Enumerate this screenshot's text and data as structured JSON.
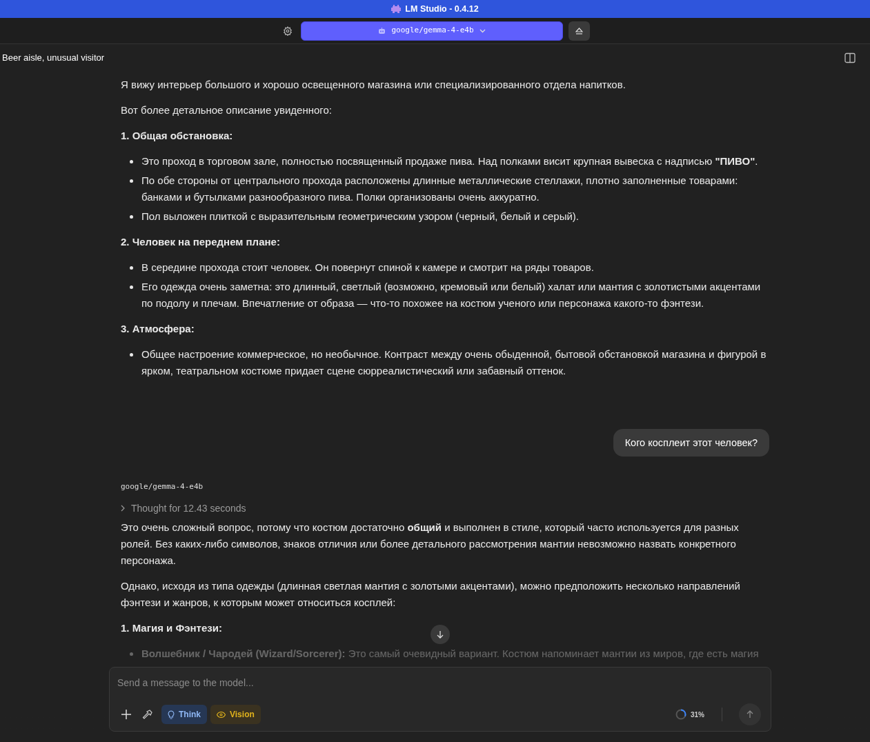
{
  "window": {
    "title": "LM Studio - 0.4.12"
  },
  "toolbar": {
    "model": "google/gemma-4-e4b"
  },
  "chat": {
    "title": "Beer aisle, unusual visitor",
    "messages": [
      {
        "kind": "assistant",
        "blocks": [
          {
            "kind": "paragraph",
            "text": "Я вижу интерьер большого и хорошо освещенного магазина или специализированного отдела напитков."
          },
          {
            "kind": "paragraph",
            "text": "Вот более детальное описание увиденного:"
          },
          {
            "kind": "heading",
            "text": "1. Общая обстановка:"
          },
          {
            "kind": "bullets",
            "items": [
              "Это проход в торговом зале, полностью посвященный продаже пива. Над полками висит крупная вывеска с надписью **\"ПИВО\"**.",
              "По обе стороны от центрального прохода расположены длинные металлические стеллажи, плотно заполненные товарами: банками и бутылками разнообразного пива. Полки организованы очень аккуратно.",
              "Пол выложен плиткой с выразительным геометрическим узором (черный, белый и серый)."
            ]
          },
          {
            "kind": "heading",
            "text": "2. Человек на переднем плане:"
          },
          {
            "kind": "bullets",
            "items": [
              "В середине прохода стоит человек. Он повернут спиной к камере и смотрит на ряды товаров.",
              "Его одежда очень заметна: это длинный, светлый (возможно, кремовый или белый) халат или мантия с золотистыми акцентами по подолу и плечам. Впечатление от образа — что-то похожее на костюм ученого или персонажа какого-то фэнтези."
            ]
          },
          {
            "kind": "heading",
            "text": "3. Атмосфера:"
          },
          {
            "kind": "bullets",
            "items": [
              "Общее настроение коммерческое, но необычное. Контраст между очень обыденной, бытовой обстановкой магазина и фигурой в ярком, театральном костюме придает сцене сюрреалистический или забавный оттенок."
            ]
          }
        ]
      },
      {
        "kind": "user",
        "text": "Кого косплеит этот человек?"
      },
      {
        "kind": "assistant",
        "model": "google/gemma-4-e4b",
        "thought": "Thought for 12.43 seconds",
        "blocks": [
          {
            "kind": "paragraph",
            "text": "Это очень сложный вопрос, потому что костюм достаточно **общий** и выполнен в стиле, который часто используется для разных ролей. Без каких-либо символов, знаков отличия или более детального рассмотрения мантии невозможно назвать конкретного персонажа."
          },
          {
            "kind": "paragraph",
            "text": "Однако, исходя из типа одежды (длинная светлая мантия с золотыми акцентами), можно предположить несколько направлений фэнтези и жанров, к которым может относиться косплей:"
          },
          {
            "kind": "heading",
            "text": "1. Магия и Фэнтези:"
          },
          {
            "kind": "bullets",
            "faded": true,
            "items": [
              "**Волшебник / Чародей (Wizard/Sorcerer):** Это самый очевидный вариант. Костюм напоминает мантии из миров, где есть магия"
            ]
          }
        ]
      }
    ]
  },
  "composer": {
    "placeholder": "Send a message to the model...",
    "toggles": [
      {
        "label": "Think",
        "kind": "think",
        "on": true
      },
      {
        "label": "Vision",
        "kind": "vision",
        "on": true
      }
    ],
    "context": {
      "level": 0.31,
      "reading": "31%"
    }
  }
}
